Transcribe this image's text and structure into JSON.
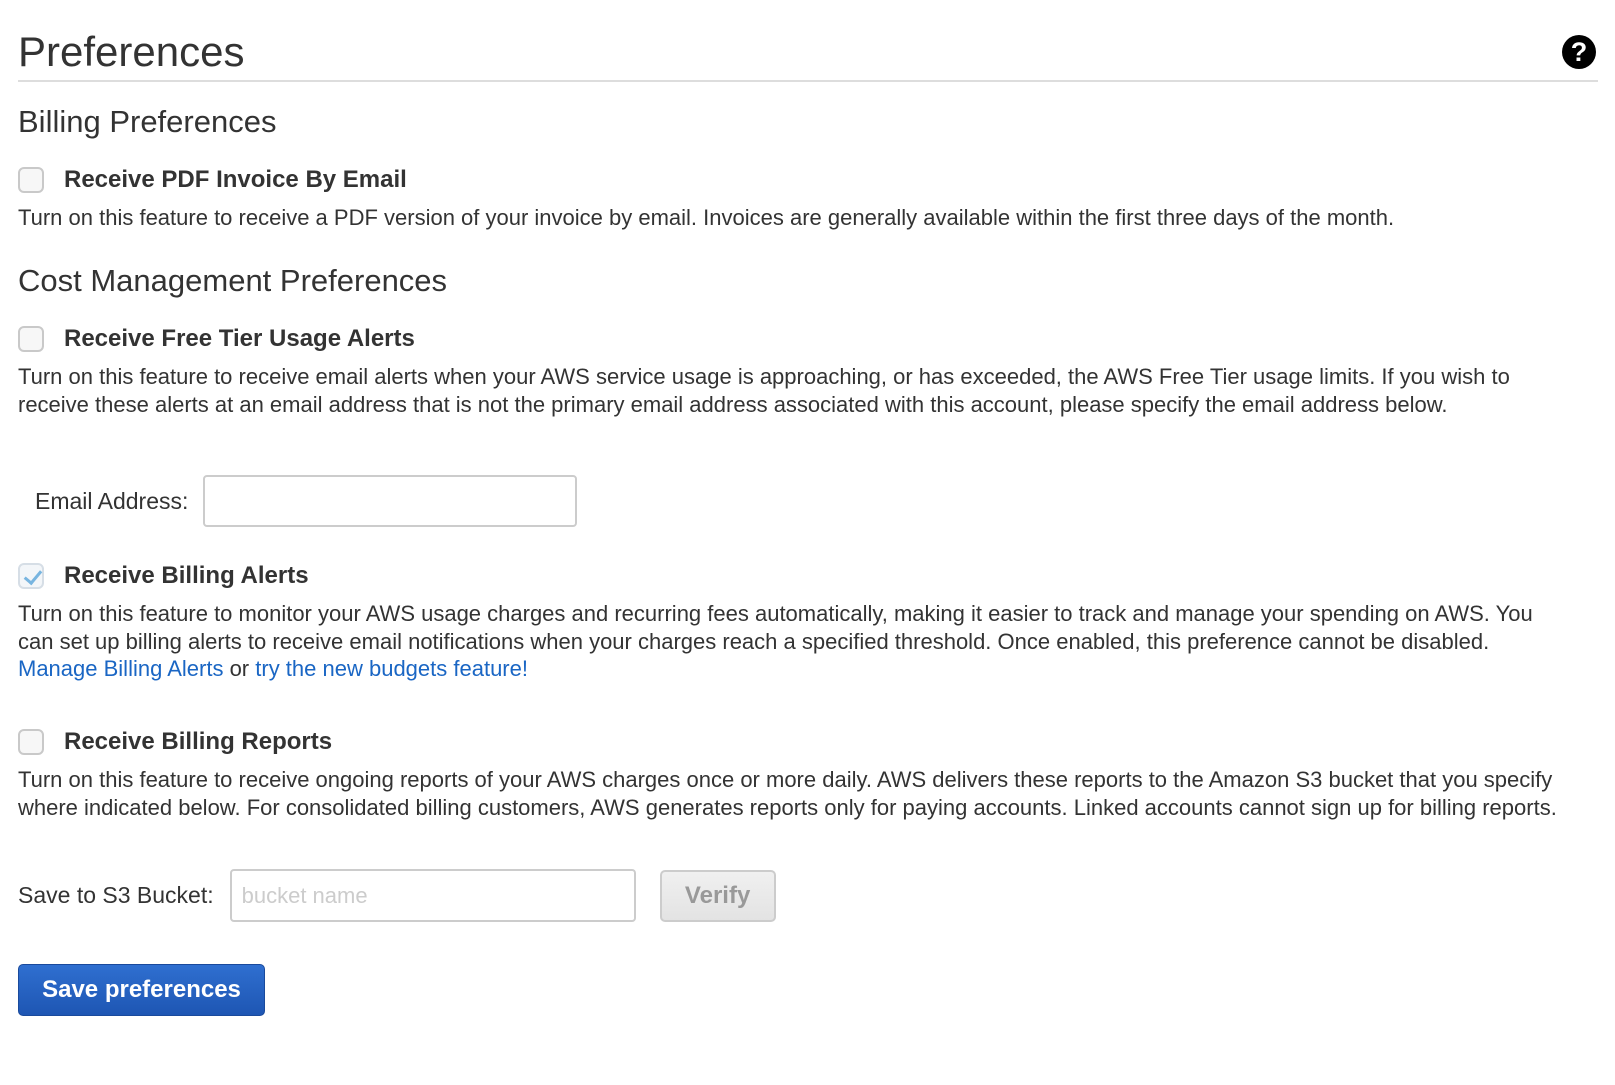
{
  "header": {
    "title": "Preferences",
    "help_icon": "?"
  },
  "billing": {
    "section_title": "Billing Preferences",
    "pdf_invoice": {
      "label": "Receive PDF Invoice By Email",
      "checked": false,
      "description": "Turn on this feature to receive a PDF version of your invoice by email. Invoices are generally available within the first three days of the month."
    }
  },
  "cost_management": {
    "section_title": "Cost Management Preferences",
    "free_tier": {
      "label": "Receive Free Tier Usage Alerts",
      "checked": false,
      "description": "Turn on this feature to receive email alerts when your AWS service usage is approaching, or has exceeded, the AWS Free Tier usage limits. If you wish to receive these alerts at an email address that is not the primary email address associated with this account, please specify the email address below.",
      "email_label": "Email Address:",
      "email_value": ""
    },
    "billing_alerts": {
      "label": "Receive Billing Alerts",
      "checked": true,
      "description": "Turn on this feature to monitor your AWS usage charges and recurring fees automatically, making it easier to track and manage your spending on AWS. You can set up billing alerts to receive email notifications when your charges reach a specified threshold. Once enabled, this preference cannot be disabled. ",
      "manage_link": "Manage Billing Alerts",
      "or_text": " or ",
      "budgets_link": "try the new budgets feature!"
    },
    "billing_reports": {
      "label": "Receive Billing Reports",
      "checked": false,
      "description": "Turn on this feature to receive ongoing reports of your AWS charges once or more daily. AWS delivers these reports to the Amazon S3 bucket that you specify where indicated below. For consolidated billing customers, AWS generates reports only for paying accounts. Linked accounts cannot sign up for billing reports.",
      "bucket_label": "Save to S3 Bucket:",
      "bucket_placeholder": "bucket name",
      "verify_label": "Verify"
    }
  },
  "actions": {
    "save_label": "Save preferences"
  },
  "colors": {
    "link": "#1a66c4",
    "primary_button": "#1e56b3",
    "text": "#333333"
  }
}
